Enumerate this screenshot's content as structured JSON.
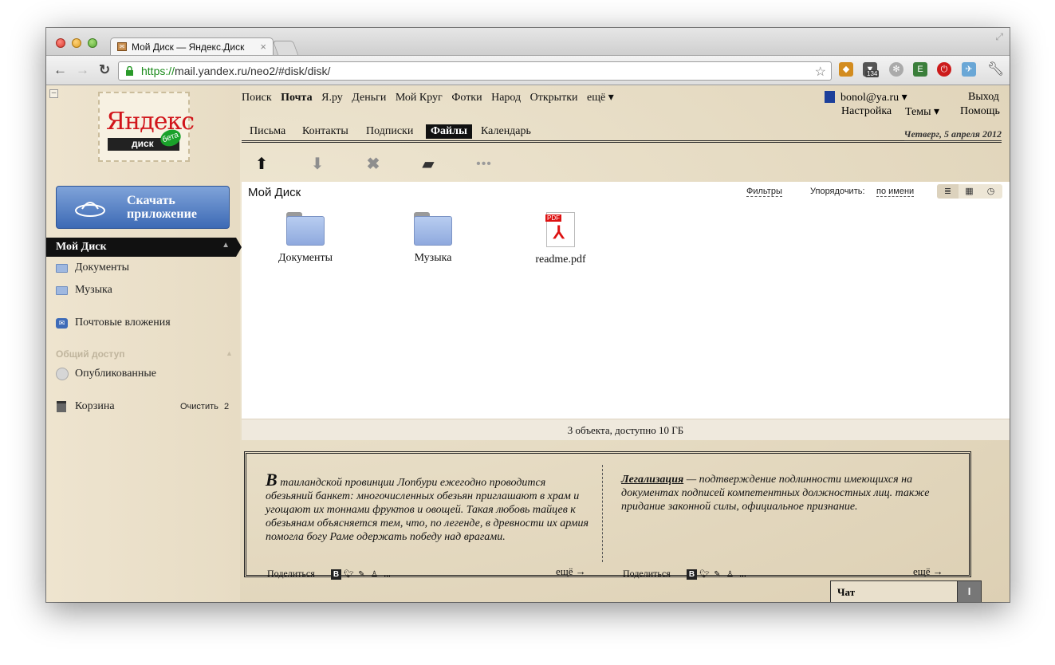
{
  "browser": {
    "tab_title": "Мой Диск — Яндекс.Диск",
    "url_protocol": "https://",
    "url_host": "mail.yandex.ru",
    "url_path": "/neo2/#disk/disk/",
    "extension_badge": "134"
  },
  "logo": {
    "text": "Яндекс",
    "subtitle": "диск",
    "beta": "бета"
  },
  "download_app": {
    "label_line1": "Скачать",
    "label_line2": "приложение"
  },
  "sidebar": {
    "my_disk": "Мой Диск",
    "items": [
      {
        "label": "Документы"
      },
      {
        "label": "Музыка"
      },
      {
        "label": "Почтовые вложения"
      }
    ],
    "shared_header": "Общий доступ",
    "published": "Опубликованные",
    "trash": "Корзина",
    "trash_clear": "Очистить",
    "trash_count": "2"
  },
  "topnav": {
    "links": [
      "Поиск",
      "Почта",
      "Я.ру",
      "Деньги",
      "Мой Круг",
      "Фотки",
      "Народ",
      "Открытки",
      "ещё ▾"
    ],
    "user": "bonol@ya.ru ▾",
    "logout": "Выход",
    "settings": "Настройка",
    "themes": "Темы ▾",
    "help": "Помощь"
  },
  "subtabs": {
    "items": [
      "Письма",
      "Контакты",
      "Подписки",
      "Файлы",
      "Календарь"
    ],
    "active": "Файлы",
    "date": "Четверг, 5 апреля 2012"
  },
  "actions": {
    "upload_icon": "upload-icon",
    "download_icon": "download-icon",
    "delete_icon": "delete-icon",
    "new_folder_icon": "new-folder-icon",
    "more": "•••"
  },
  "main": {
    "title": "Мой Диск",
    "filters": "Фильтры",
    "sort_label": "Упорядочить:",
    "sort_value": "по имени",
    "files": [
      {
        "name": "Документы",
        "type": "folder"
      },
      {
        "name": "Музыка",
        "type": "folder"
      },
      {
        "name": "readme.pdf",
        "type": "pdf"
      }
    ],
    "status": "3 объекта, доступно 10 ГБ"
  },
  "facts": {
    "fact1_dropcap": "В",
    "fact1_text": " таиландской провинции Лопбури ежегодно проводится обезьяний банкет: многочисленных обезьян приглашают в храм и угощают их тоннами фруктов и овощей. Такая любовь тайцев к обезьянам объясняется тем, что, по легенде, в древности их армия помогла богу Раме одержать победу над врагами.",
    "fact2_term": "Легализация",
    "fact2_text": " — подтверждение подлинности имеющихся на документах подписей компетентных должностных лиц. также придание законной силы, официальное признание.",
    "share_label": "Поделиться",
    "share_more": "...",
    "more_link": "ещё →"
  },
  "chat": {
    "label": "Чат",
    "toggle": "I"
  }
}
